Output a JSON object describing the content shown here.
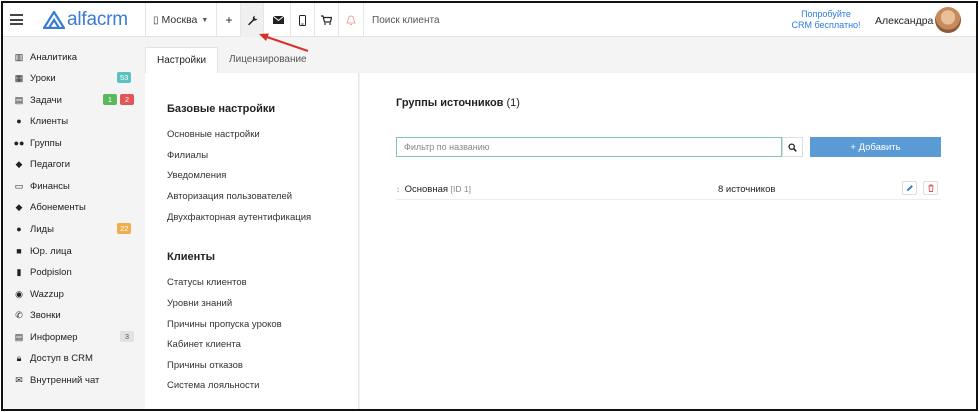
{
  "topbar": {
    "logo_text": "alfacrm",
    "city": "Москва",
    "search_placeholder": "Поиск клиента",
    "promo_line1": "Попробуйте",
    "promo_line2": "CRM бесплатно!",
    "user_name": "Александра"
  },
  "sidebar": {
    "items": [
      {
        "label": "Аналитика",
        "icon": "chart-icon"
      },
      {
        "label": "Уроки",
        "icon": "calendar-icon",
        "badge": "53",
        "badge_color": "#5bc0be"
      },
      {
        "label": "Задачи",
        "icon": "clipboard-icon",
        "badge1": "1",
        "badge1_color": "#5cb85c",
        "badge2": "2",
        "badge2_color": "#e05555"
      },
      {
        "label": "Клиенты",
        "icon": "user-icon"
      },
      {
        "label": "Группы",
        "icon": "users-icon"
      },
      {
        "label": "Педагоги",
        "icon": "graduation-cap-icon"
      },
      {
        "label": "Финансы",
        "icon": "money-icon"
      },
      {
        "label": "Абонементы",
        "icon": "tag-icon"
      },
      {
        "label": "Лиды",
        "icon": "user-plus-icon",
        "badge": "22",
        "badge_color": "#f0ad4e"
      },
      {
        "label": "Юр. лица",
        "icon": "briefcase-icon"
      },
      {
        "label": "Podpislon",
        "icon": "document-icon"
      },
      {
        "label": "Wazzup",
        "icon": "whatsapp-icon"
      },
      {
        "label": "Звонки",
        "icon": "phone-icon"
      },
      {
        "label": "Информер",
        "icon": "list-icon",
        "badge": "3",
        "badge_color": "#e2e2e2"
      },
      {
        "label": "Доступ в CRM",
        "icon": "lock-icon"
      },
      {
        "label": "Внутренний чат",
        "icon": "envelope-icon"
      }
    ]
  },
  "tabs": [
    {
      "label": "Настройки",
      "active": true
    },
    {
      "label": "Лицензирование",
      "active": false
    }
  ],
  "settings": {
    "basic_title": "Базовые настройки",
    "basic_items": [
      "Основные настройки",
      "Филиалы",
      "Уведомления",
      "Авторизация пользователей",
      "Двухфакторная аутентификация"
    ],
    "clients_title": "Клиенты",
    "clients_items": [
      "Статусы клиентов",
      "Уровни знаний",
      "Причины пропуска уроков",
      "Кабинет клиента",
      "Причины отказов",
      "Система лояльности"
    ]
  },
  "content": {
    "title": "Группы источников",
    "count": "(1)",
    "filter_placeholder": "Фильтр по названию",
    "add_label": "+ Добавить",
    "rows": [
      {
        "name": "Основная",
        "id": "[ID 1]",
        "sources": "8 источников"
      }
    ]
  },
  "colors": {
    "accent": "#5b9bd5",
    "arrow": "#d9302c",
    "filter_border": "#7fc7b8"
  }
}
